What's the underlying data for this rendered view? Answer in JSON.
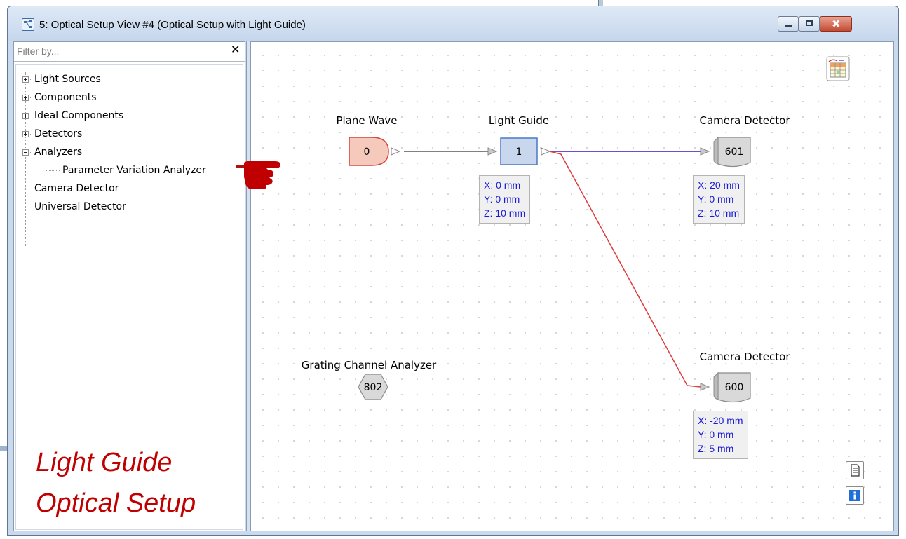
{
  "window": {
    "title": "5: Optical Setup View #4 (Optical Setup with Light Guide)",
    "icon": "optical-setup-icon",
    "controls": {
      "minimize": "minimize-icon",
      "maximize": "maximize-icon",
      "close": "✖"
    }
  },
  "filter": {
    "placeholder": "Filter by...",
    "value": "",
    "clear": "✕"
  },
  "tree": {
    "items": [
      {
        "label": "Light Sources",
        "expander": "plus"
      },
      {
        "label": "Components",
        "expander": "plus"
      },
      {
        "label": "Ideal Components",
        "expander": "plus"
      },
      {
        "label": "Detectors",
        "expander": "plus"
      },
      {
        "label": "Analyzers",
        "expander": "minus"
      },
      {
        "label": "Parameter Variation Analyzer",
        "expander": "none"
      },
      {
        "label": "Camera Detector",
        "expander": "none"
      },
      {
        "label": "Universal Detector",
        "expander": "none"
      }
    ]
  },
  "overlay": {
    "line1": "Light Guide",
    "line2": "Optical Setup",
    "color": "#c00000"
  },
  "canvas": {
    "nodes": {
      "plane_wave": {
        "label": "Plane Wave",
        "id": "0",
        "color": "#f6c9bd",
        "border": "#d1473a"
      },
      "light_guide": {
        "label": "Light Guide",
        "id": "1",
        "color": "#c8d7ee",
        "border": "#4878c4",
        "coords": {
          "x": "X: 0 mm",
          "y": "Y: 0 mm",
          "z": "Z: 10 mm"
        }
      },
      "camera_top": {
        "label": "Camera Detector",
        "id": "601",
        "coords": {
          "x": "X: 20 mm",
          "y": "Y: 0 mm",
          "z": "Z: 10 mm"
        }
      },
      "camera_bottom": {
        "label": "Camera Detector",
        "id": "600",
        "coords": {
          "x": "X: -20 mm",
          "y": "Y: 0 mm",
          "z": "Z: 5 mm"
        }
      },
      "grating": {
        "label": "Grating Channel Analyzer",
        "id": "802"
      }
    },
    "connection_colors": {
      "plane_to_guide": "#808080",
      "guide_to_cam601": "#6a4fcf",
      "guide_to_cam600": "#e03a3a"
    },
    "tools": {
      "table_icon": "table-view-icon",
      "document_icon": "document-icon",
      "info_icon": "info-icon"
    }
  }
}
